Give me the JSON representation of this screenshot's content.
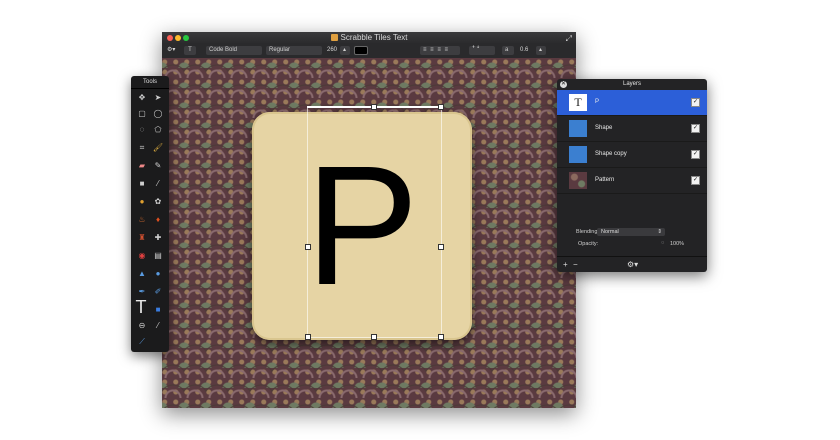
{
  "window": {
    "title": "Scrabble Tiles Text"
  },
  "toolbar": {
    "font_family": "Code Bold",
    "font_style": "Regular",
    "font_size": "260",
    "opacity_value": "0.6"
  },
  "canvas": {
    "tile_letter": "P"
  },
  "tools_panel": {
    "title": "Tools"
  },
  "layers_panel": {
    "title": "Layers",
    "layers": [
      {
        "name": "P",
        "type": "text",
        "selected": true,
        "visible": true
      },
      {
        "name": "Shape",
        "type": "shape",
        "selected": false,
        "visible": true
      },
      {
        "name": "Shape copy",
        "type": "shape",
        "selected": false,
        "visible": true
      },
      {
        "name": "Pattern",
        "type": "pattern",
        "selected": false,
        "visible": true
      }
    ],
    "blending_label": "Blending:",
    "blending_value": "Normal",
    "opacity_label": "Opacity:",
    "opacity_value": "100%"
  },
  "colors": {
    "selection": "#2c5fd8",
    "tile": "#e6d4a4",
    "panel_bg": "#232325"
  }
}
